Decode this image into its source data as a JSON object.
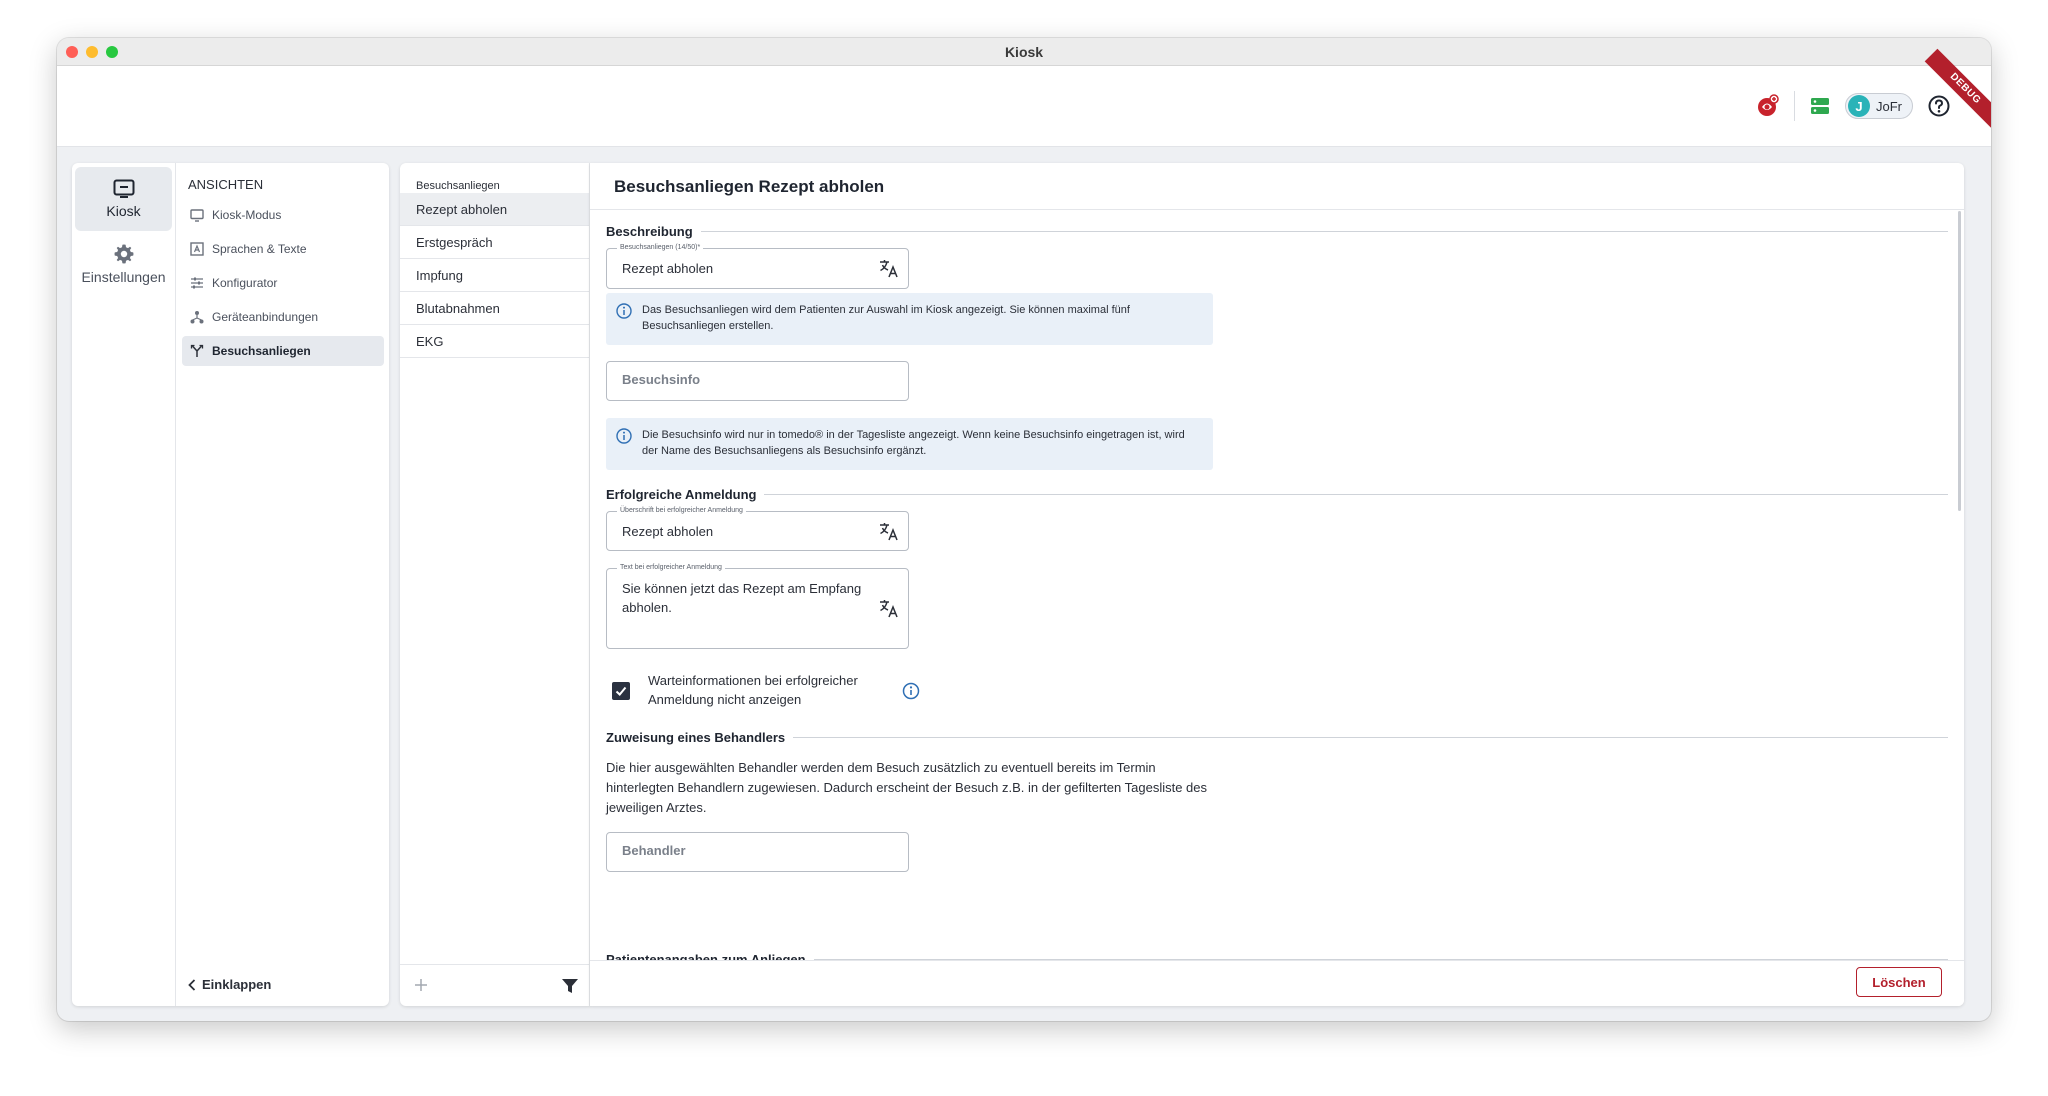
{
  "window": {
    "title": "Kiosk"
  },
  "topbar": {
    "user_initial": "J",
    "user_name": "JoFr",
    "debug_label": "DEBUG"
  },
  "rail": [
    {
      "label": "Kiosk",
      "icon": "kiosk-monitor-icon",
      "active": true
    },
    {
      "label": "Einstellungen",
      "icon": "gear-icon",
      "active": false
    }
  ],
  "nav": {
    "heading": "ANSICHTEN",
    "items": [
      {
        "label": "Kiosk-Modus",
        "icon": "monitor-icon"
      },
      {
        "label": "Sprachen & Texte",
        "icon": "text-frame-icon"
      },
      {
        "label": "Konfigurator",
        "icon": "sliders-icon"
      },
      {
        "label": "Geräteanbindungen",
        "icon": "network-icon"
      },
      {
        "label": "Besuchsanliegen",
        "icon": "branch-icon",
        "active": true
      }
    ],
    "collapse_label": "Einklappen"
  },
  "list": {
    "heading": "Besuchsanliegen",
    "items": [
      "Rezept abholen",
      "Erstgespräch",
      "Impfung",
      "Blutabnahmen",
      "EKG"
    ],
    "active_index": 0
  },
  "detail": {
    "title": "Besuchsanliegen Rezept abholen",
    "sections": {
      "beschreibung": "Beschreibung",
      "erfolgreich": "Erfolgreiche Anmeldung",
      "zuweisung": "Zuweisung eines Behandlers",
      "patientenangaben": "Patientenangaben zum Anliegen"
    },
    "fields": {
      "besuchsanliegen_label": "Besuchsanliegen (14/50)*",
      "besuchsanliegen_value": "Rezept abholen",
      "besuchsinfo_placeholder": "Besuchsinfo",
      "ueberschrift_label": "Überschrift bei erfolgreicher Anmeldung",
      "ueberschrift_value": "Rezept abholen",
      "text_label": "Text bei erfolgreicher Anmeldung",
      "text_value": "Sie können jetzt das Rezept am Empfang abholen.",
      "behandler_placeholder": "Behandler"
    },
    "info": {
      "besuchsanliegen": "Das Besuchsanliegen wird dem Patienten zur Auswahl im Kiosk angezeigt. Sie können maximal fünf Besuchsanliegen erstellen.",
      "besuchsinfo": "Die Besuchsinfo wird nur in tomedo® in der Tagesliste angezeigt. Wenn keine Besuchsinfo eingetragen ist, wird der Name des Besuchsanliegens als Besuchsinfo ergänzt."
    },
    "checkbox": {
      "label": "Warteinformationen bei erfolgreicher Anmeldung nicht anzeigen",
      "checked": true
    },
    "zuweisung_text": "Die hier ausgewählten Behandler werden dem Besuch zusätzlich zu eventuell bereits im Termin hinterlegten Behandlern zugewiesen. Dadurch erscheint der Besuch z.B. in der gefilterten Tagesliste des jeweiligen Arztes.",
    "delete_label": "Löschen"
  },
  "colors": {
    "accent": "#2a3140",
    "danger": "#b3202c",
    "info_bg": "#e9f0f8",
    "info_icon": "#2f6fb4",
    "avatar": "#2ab3b8",
    "server_icon": "#2fa84f"
  }
}
